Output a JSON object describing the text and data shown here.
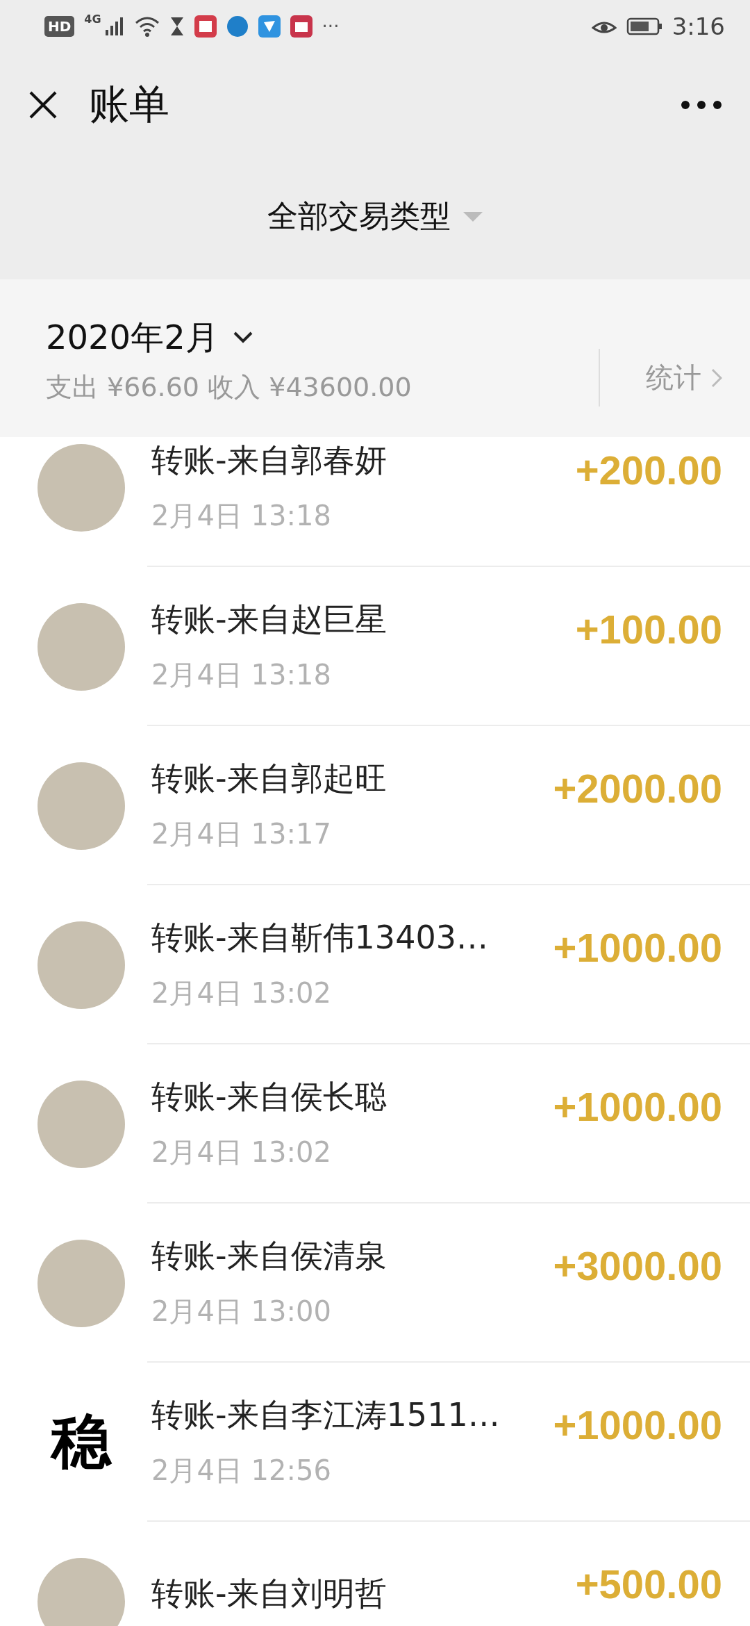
{
  "status_bar": {
    "hd_badge": "HD",
    "network": "4G",
    "more": "···",
    "time": "3:16"
  },
  "header": {
    "title": "账单",
    "filter": "全部交易类型"
  },
  "summary": {
    "month": "2020年2月",
    "totals": "支出 ¥66.60 收入 ¥43600.00",
    "stats_link": "统计"
  },
  "transactions": [
    {
      "avatar": {
        "kind": "photo"
      },
      "title": "转账-来自郭春妍",
      "time": "2月4日 13:18",
      "amount": "+200.00"
    },
    {
      "avatar": {
        "kind": "photo"
      },
      "title": "转账-来自赵巨星",
      "time": "2月4日 13:18",
      "amount": "+100.00"
    },
    {
      "avatar": {
        "kind": "photo"
      },
      "title": "转账-来自郭起旺",
      "time": "2月4日 13:17",
      "amount": "+2000.00"
    },
    {
      "avatar": {
        "kind": "photo"
      },
      "title": "转账-来自靳伟13403…",
      "time": "2月4日 13:02",
      "amount": "+1000.00"
    },
    {
      "avatar": {
        "kind": "photo"
      },
      "title": "转账-来自侯长聪",
      "time": "2月4日 13:02",
      "amount": "+1000.00"
    },
    {
      "avatar": {
        "kind": "photo"
      },
      "title": "转账-来自侯清泉",
      "time": "2月4日 13:00",
      "amount": "+3000.00"
    },
    {
      "avatar": {
        "kind": "glyph",
        "text": "稳"
      },
      "title": "转账-来自李江涛1511…",
      "time": "2月4日 12:56",
      "amount": "+1000.00"
    },
    {
      "avatar": {
        "kind": "photo"
      },
      "title": "转账-来自刘明哲",
      "amount": "+500.00"
    }
  ]
}
